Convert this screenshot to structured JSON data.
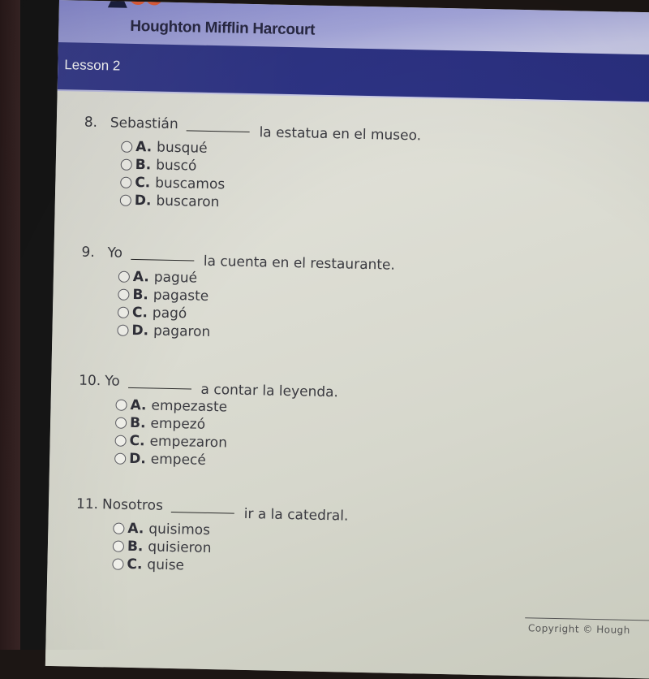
{
  "header": {
    "brand": "Houghton Mifflin Harcourt",
    "lesson_title": "Lesson 2",
    "colors": {
      "brand_blue": "#2e3486",
      "logo_orange": "#e8603c",
      "logo_navy": "#1d2140"
    }
  },
  "questions": [
    {
      "number": "8.",
      "before": "Sebastián",
      "after": "la estatua en el museo.",
      "options": [
        {
          "letter": "A.",
          "text": "busqué"
        },
        {
          "letter": "B.",
          "text": "buscó"
        },
        {
          "letter": "C.",
          "text": "buscamos"
        },
        {
          "letter": "D.",
          "text": "buscaron"
        }
      ]
    },
    {
      "number": "9.",
      "before": "Yo",
      "after": "la cuenta en el restaurante.",
      "options": [
        {
          "letter": "A.",
          "text": "pagué"
        },
        {
          "letter": "B.",
          "text": "pagaste"
        },
        {
          "letter": "C.",
          "text": "pagó"
        },
        {
          "letter": "D.",
          "text": "pagaron"
        }
      ]
    },
    {
      "number": "10.",
      "before": "Yo",
      "after": "a contar la leyenda.",
      "options": [
        {
          "letter": "A.",
          "text": "empezaste"
        },
        {
          "letter": "B.",
          "text": "empezó"
        },
        {
          "letter": "C.",
          "text": "empezaron"
        },
        {
          "letter": "D.",
          "text": "empecé"
        }
      ]
    },
    {
      "number": "11.",
      "before": "Nosotros",
      "after": "ir a la catedral.",
      "options": [
        {
          "letter": "A.",
          "text": "quisimos"
        },
        {
          "letter": "B.",
          "text": "quisieron"
        },
        {
          "letter": "C.",
          "text": "quise"
        }
      ]
    }
  ],
  "footer": {
    "copyright": "Copyright © Hough"
  }
}
